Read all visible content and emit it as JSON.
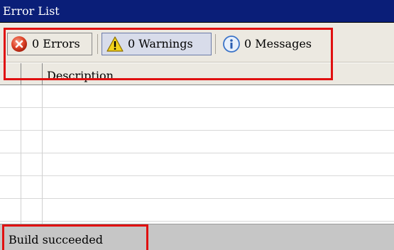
{
  "window": {
    "title": "Error List"
  },
  "toolbar": {
    "errors": {
      "label": "0 Errors",
      "icon": "error-icon",
      "color": "#e0452a"
    },
    "warnings": {
      "label": "0 Warnings",
      "icon": "warning-icon",
      "color": "#f2d21b",
      "selected": true
    },
    "messages": {
      "label": "0 Messages",
      "icon": "info-icon",
      "color": "#3a73c8"
    }
  },
  "table": {
    "columns": [
      "",
      "",
      "Description"
    ],
    "rows": [
      [],
      [],
      [],
      [],
      [],
      []
    ]
  },
  "status": {
    "text": "Build succeeded"
  },
  "highlight_color": "#e01010"
}
